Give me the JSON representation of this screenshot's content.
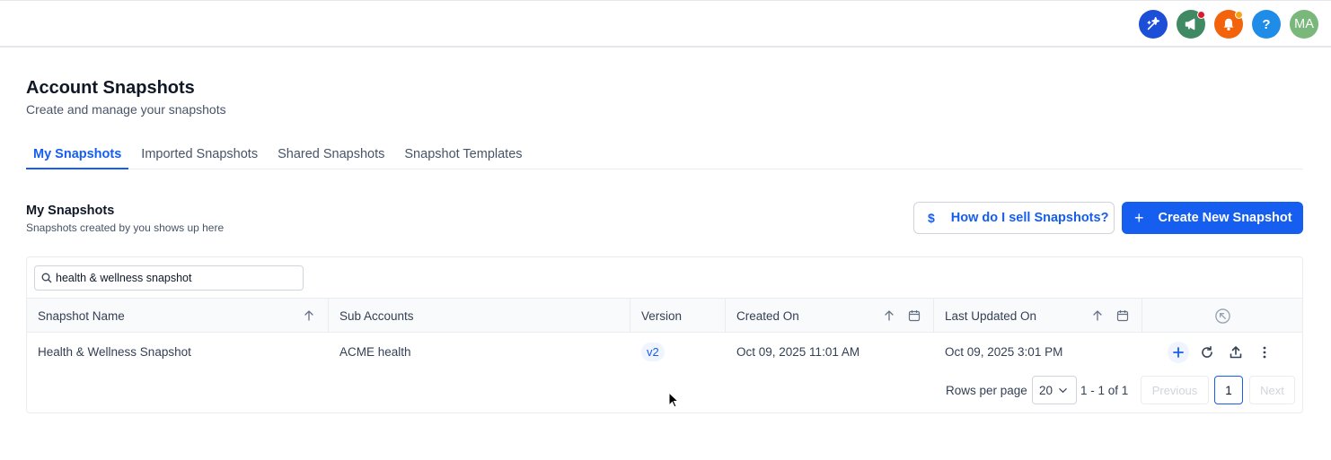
{
  "topbar": {
    "icons": [
      {
        "name": "sparkle-icon",
        "color": "#1d4ed8"
      },
      {
        "name": "megaphone-icon",
        "color": "#3f8a63",
        "badge_color": "#e0182d"
      },
      {
        "name": "bell-icon",
        "color": "#f2630c",
        "badge_color": "#f7a21b"
      },
      {
        "name": "help-icon",
        "color": "#1f8de8",
        "label": "?"
      },
      {
        "name": "avatar",
        "color": "#79b77a",
        "label": "MA"
      }
    ]
  },
  "header": {
    "title": "Account Snapshots",
    "subtitle": "Create and manage your snapshots"
  },
  "tabs": [
    {
      "label": "My Snapshots",
      "active": true
    },
    {
      "label": "Imported Snapshots",
      "active": false
    },
    {
      "label": "Shared Snapshots",
      "active": false
    },
    {
      "label": "Snapshot Templates",
      "active": false
    }
  ],
  "section": {
    "title": "My Snapshots",
    "subtitle": "Snapshots created by you shows up here"
  },
  "buttons": {
    "sell_prefix": "$",
    "sell_label": "How do I sell Snapshots?",
    "create_prefix": "+",
    "create_label": "Create New Snapshot"
  },
  "search": {
    "value": "health & wellness snapshot"
  },
  "table": {
    "columns": [
      "Snapshot Name",
      "Sub Accounts",
      "Version",
      "Created On",
      "Last Updated On"
    ],
    "rows": [
      {
        "name": "Health & Wellness Snapshot",
        "sub_accounts": "ACME health",
        "version": "v2",
        "created_on": "Oct 09, 2025 11:01 AM",
        "last_updated_on": "Oct 09, 2025 3:01 PM"
      }
    ]
  },
  "pagination": {
    "rows_per_page_label": "Rows per page",
    "rows_per_page_value": "20",
    "range": "1 - 1 of 1",
    "previous_label": "Previous",
    "current_page": "1",
    "next_label": "Next"
  },
  "colors": {
    "accent": "#155eef",
    "border": "#eaecf0",
    "text": "#344054"
  }
}
